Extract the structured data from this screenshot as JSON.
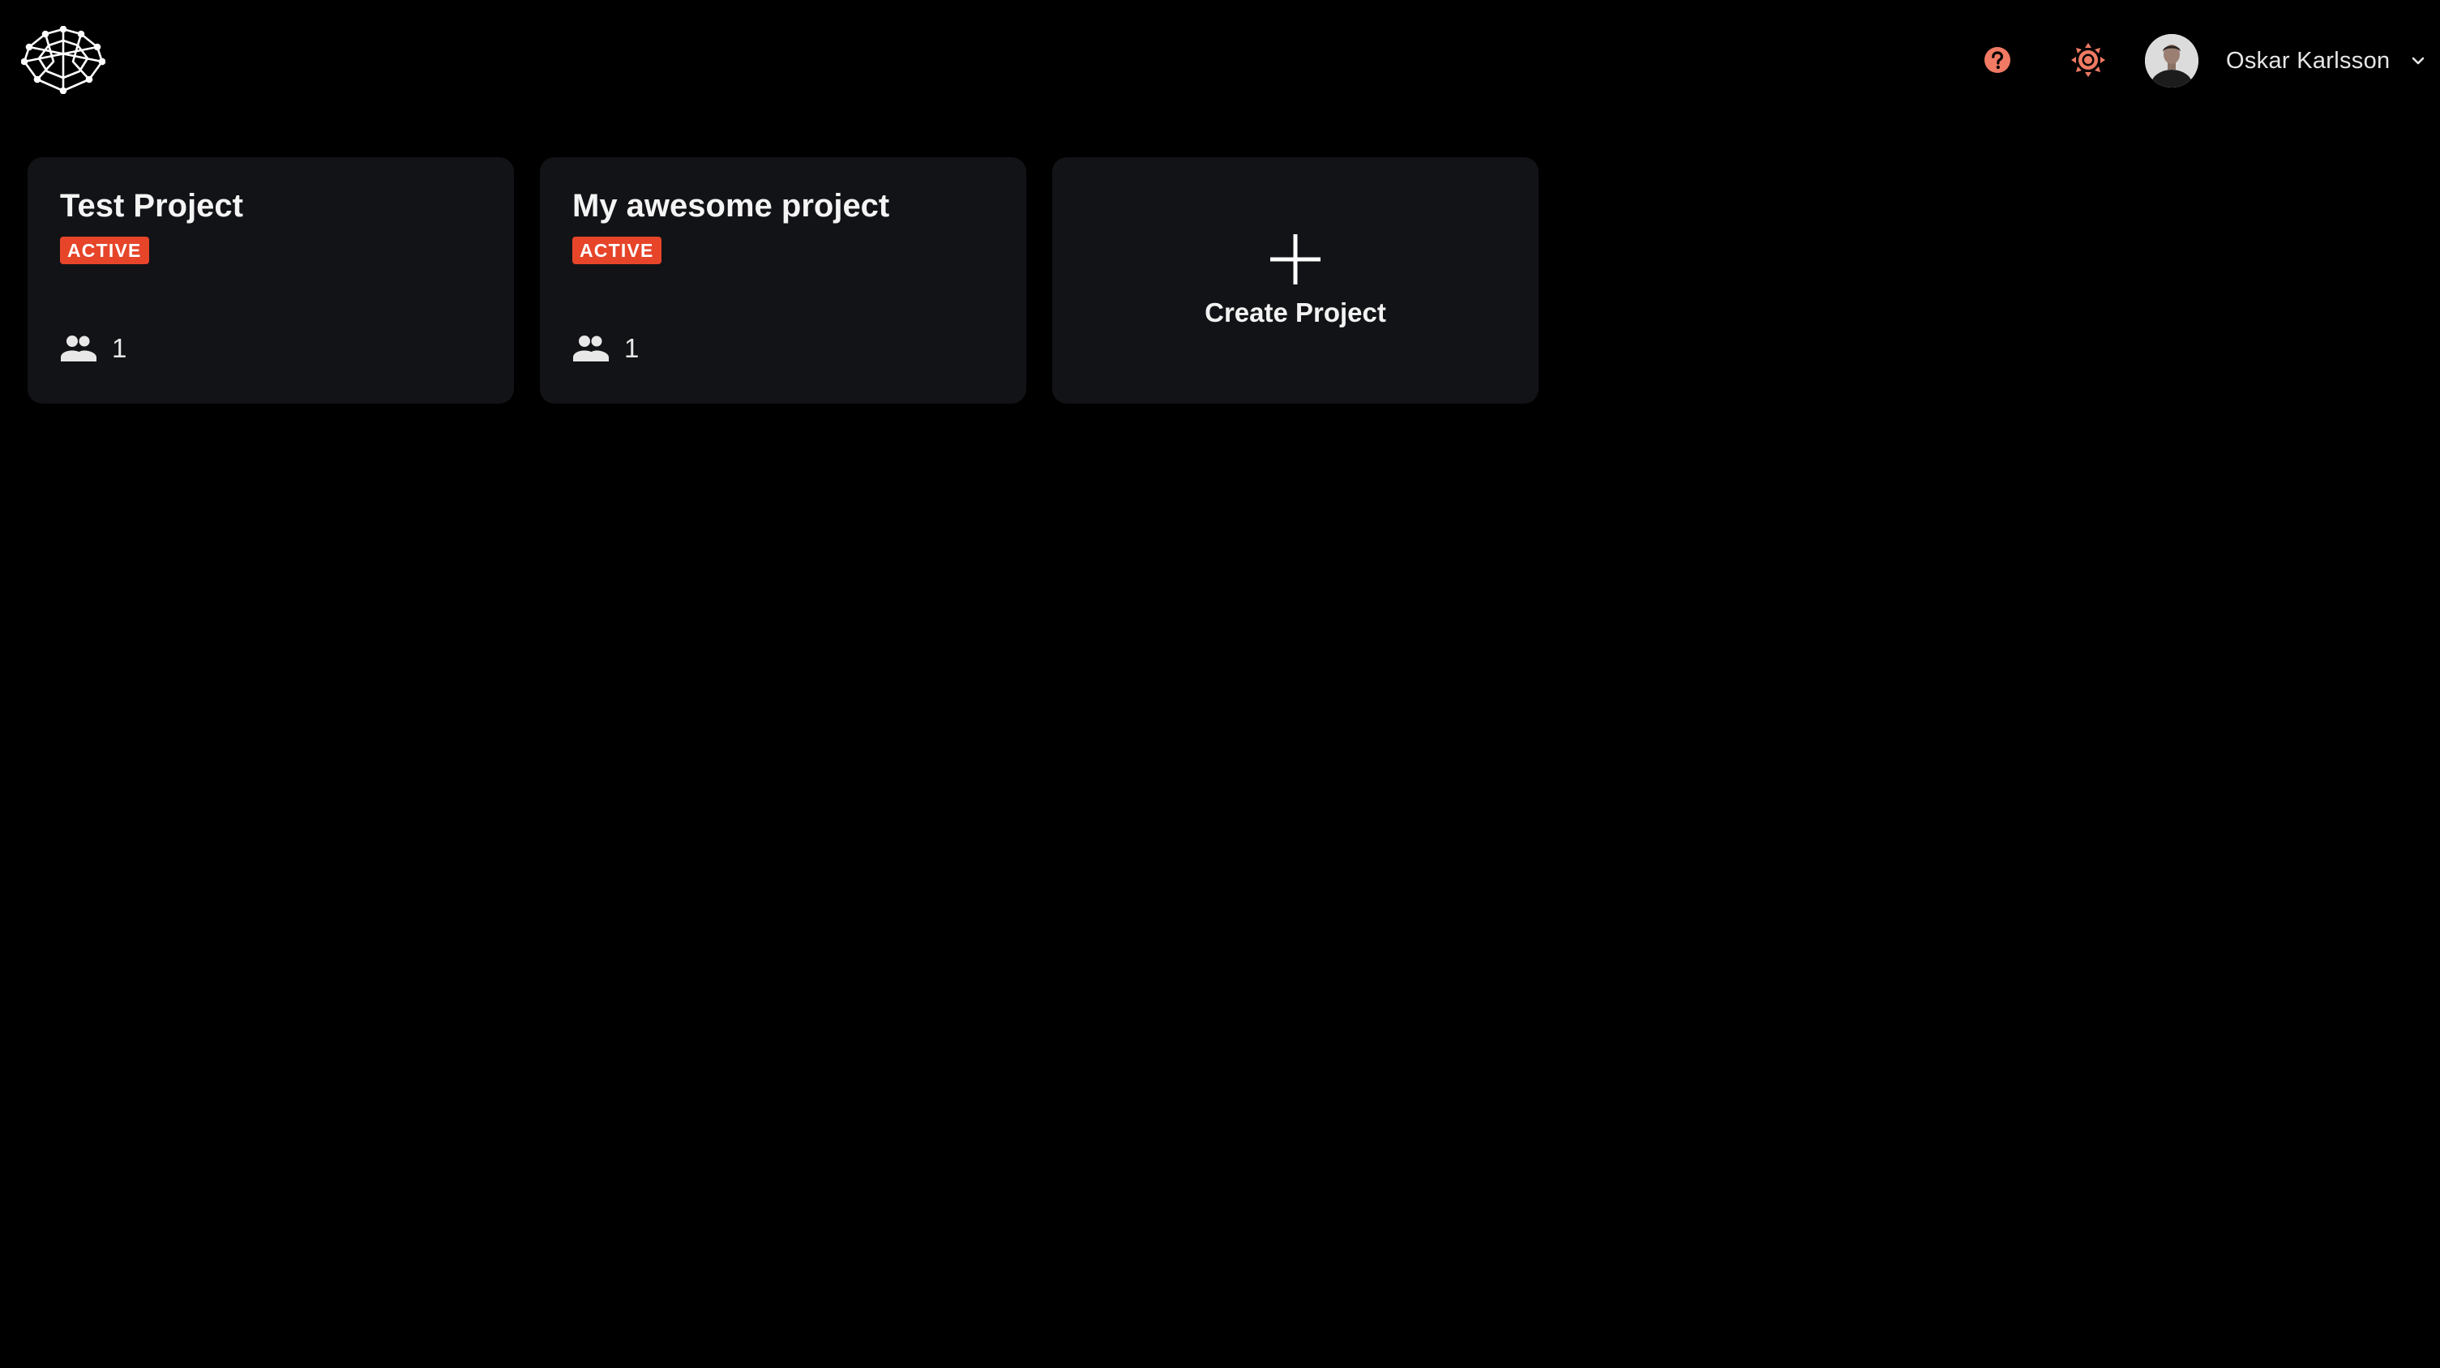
{
  "header": {
    "logo_icon": "spider-web-logo-icon",
    "help_icon": "help-icon",
    "theme_icon": "sun-icon",
    "accent_color": "#e6452a"
  },
  "user": {
    "name": "Oskar Karlsson",
    "menu_icon": "chevron-down-icon"
  },
  "projects": [
    {
      "title": "Test Project",
      "status": "ACTIVE",
      "members": "1"
    },
    {
      "title": "My awesome project",
      "status": "ACTIVE",
      "members": "1"
    }
  ],
  "create_card": {
    "label": "Create Project",
    "icon": "plus-icon"
  },
  "colors": {
    "background": "#000000",
    "card": "#121316",
    "badge": "#e6452a",
    "icon_accent": "#f07a63"
  }
}
